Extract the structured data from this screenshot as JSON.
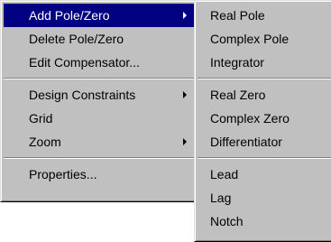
{
  "context_menu": {
    "items": [
      {
        "label": "Add Pole/Zero",
        "submenu": true,
        "highlighted": true
      },
      {
        "label": "Delete Pole/Zero",
        "submenu": false
      },
      {
        "label": "Edit Compensator...",
        "submenu": false
      },
      {
        "label": "Design Constraints",
        "submenu": true
      },
      {
        "label": "Grid",
        "submenu": false
      },
      {
        "label": "Zoom",
        "submenu": true
      },
      {
        "label": "Properties...",
        "submenu": false
      }
    ]
  },
  "submenu": {
    "items": [
      {
        "label": "Real Pole"
      },
      {
        "label": "Complex Pole"
      },
      {
        "label": "Integrator"
      },
      {
        "label": "Real Zero"
      },
      {
        "label": "Complex Zero"
      },
      {
        "label": "Differentiator"
      },
      {
        "label": "Lead"
      },
      {
        "label": "Lag"
      },
      {
        "label": "Notch"
      }
    ]
  },
  "colors": {
    "menu_background": "#c0c0c0",
    "highlight_background": "#000080",
    "highlight_text": "#ffffff"
  }
}
